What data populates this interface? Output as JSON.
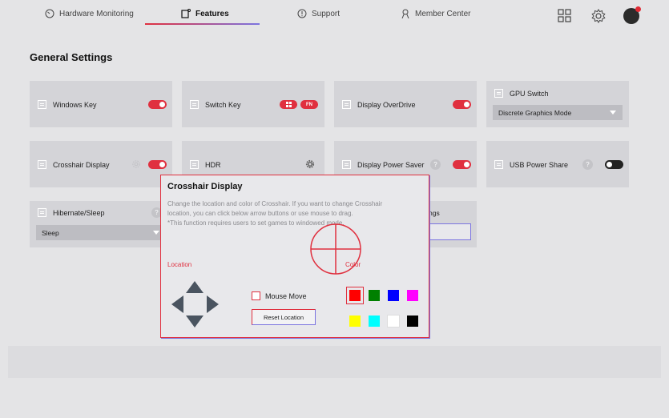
{
  "nav": {
    "items": [
      {
        "label": "Hardware Monitoring",
        "icon": "gauge-icon"
      },
      {
        "label": "Features",
        "icon": "features-icon"
      },
      {
        "label": "Support",
        "icon": "support-icon"
      },
      {
        "label": "Member Center",
        "icon": "person-icon"
      }
    ],
    "active": "Features",
    "right_icons": [
      "grid-icon",
      "gear-icon",
      "avatar"
    ]
  },
  "page": {
    "title": "General Settings"
  },
  "settings": {
    "windows_key": {
      "label": "Windows Key",
      "on": true
    },
    "switch_key": {
      "label": "Switch Key",
      "badge_fn": "FN"
    },
    "display_overdrive": {
      "label": "Display OverDrive",
      "on": true
    },
    "gpu_switch": {
      "label": "GPU Switch",
      "value": "Discrete Graphics Mode"
    },
    "crosshair_display": {
      "label": "Crosshair Display",
      "on": true
    },
    "hdr": {
      "label": "HDR"
    },
    "display_power_saver": {
      "label": "Display Power Saver",
      "on": true
    },
    "usb_power_share": {
      "label": "USB Power Share",
      "on": false
    },
    "hibernate_sleep": {
      "label": "Hibernate/Sleep",
      "value": "Sleep"
    },
    "partial_label": "ngs"
  },
  "popup": {
    "title": "Crosshair Display",
    "desc_line1": "Change the location and color of Crosshair. If you want to change Crosshair",
    "desc_line2": "location, you can click below arrow buttons or use mouse to drag.",
    "desc_line3": "*This function requires users to set games to windowed mode.",
    "location_label": "Location",
    "color_label": "Color",
    "mouse_move_label": "Mouse Move",
    "mouse_move_checked": false,
    "reset_label": "Reset Location",
    "colors": [
      "#ff0000",
      "#008000",
      "#0000ff",
      "#ff00ff",
      "#ffff00",
      "#00ffff",
      "#ffffff",
      "#000000"
    ],
    "selected_color": "#ff0000",
    "accent": "#e0303f"
  }
}
